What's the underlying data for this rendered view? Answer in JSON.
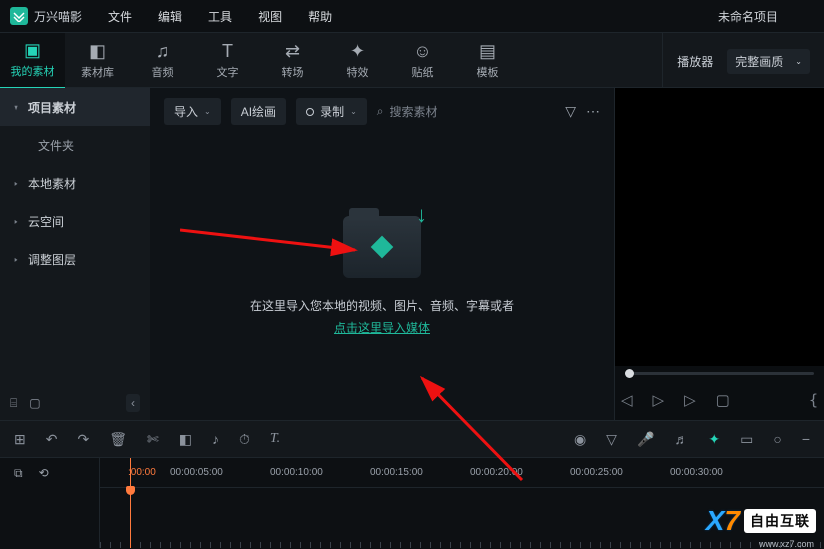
{
  "app": {
    "name": "万兴喵影",
    "project": "未命名项目"
  },
  "menu": [
    "文件",
    "编辑",
    "工具",
    "视图",
    "帮助"
  ],
  "tabs": [
    {
      "icon": "folder",
      "label": "我的素材",
      "active": true
    },
    {
      "icon": "box",
      "label": "素材库"
    },
    {
      "icon": "music",
      "label": "音频"
    },
    {
      "icon": "text",
      "label": "文字"
    },
    {
      "icon": "transition",
      "label": "转场"
    },
    {
      "icon": "fx",
      "label": "特效"
    },
    {
      "icon": "sticker",
      "label": "贴纸"
    },
    {
      "icon": "template",
      "label": "模板"
    }
  ],
  "preview_header": {
    "title": "播放器",
    "quality": "完整画质"
  },
  "sidebar": {
    "items": [
      {
        "label": "项目素材",
        "strong": true,
        "hasArrow": true
      },
      {
        "label": "文件夹",
        "sub": true
      },
      {
        "label": "本地素材",
        "hasArrow": true
      },
      {
        "label": "云空间",
        "hasArrow": true
      },
      {
        "label": "调整图层",
        "hasArrow": true
      }
    ]
  },
  "content_toolbar": {
    "import": "导入",
    "ai": "AI绘画",
    "record": "录制",
    "search": "搜索素材"
  },
  "drop": {
    "text": "在这里导入您本地的视频、图片、音频、字幕或者",
    "link": "点击这里导入媒体"
  },
  "ruler": [
    ":00:00",
    "00:00:05:00",
    "00:00:10:00",
    "00:00:15:00",
    "00:00:20:00",
    "00:00:25:00",
    "00:00:30:00"
  ],
  "watermark": {
    "brand": "自由互联",
    "url": "www.xz7.com"
  }
}
